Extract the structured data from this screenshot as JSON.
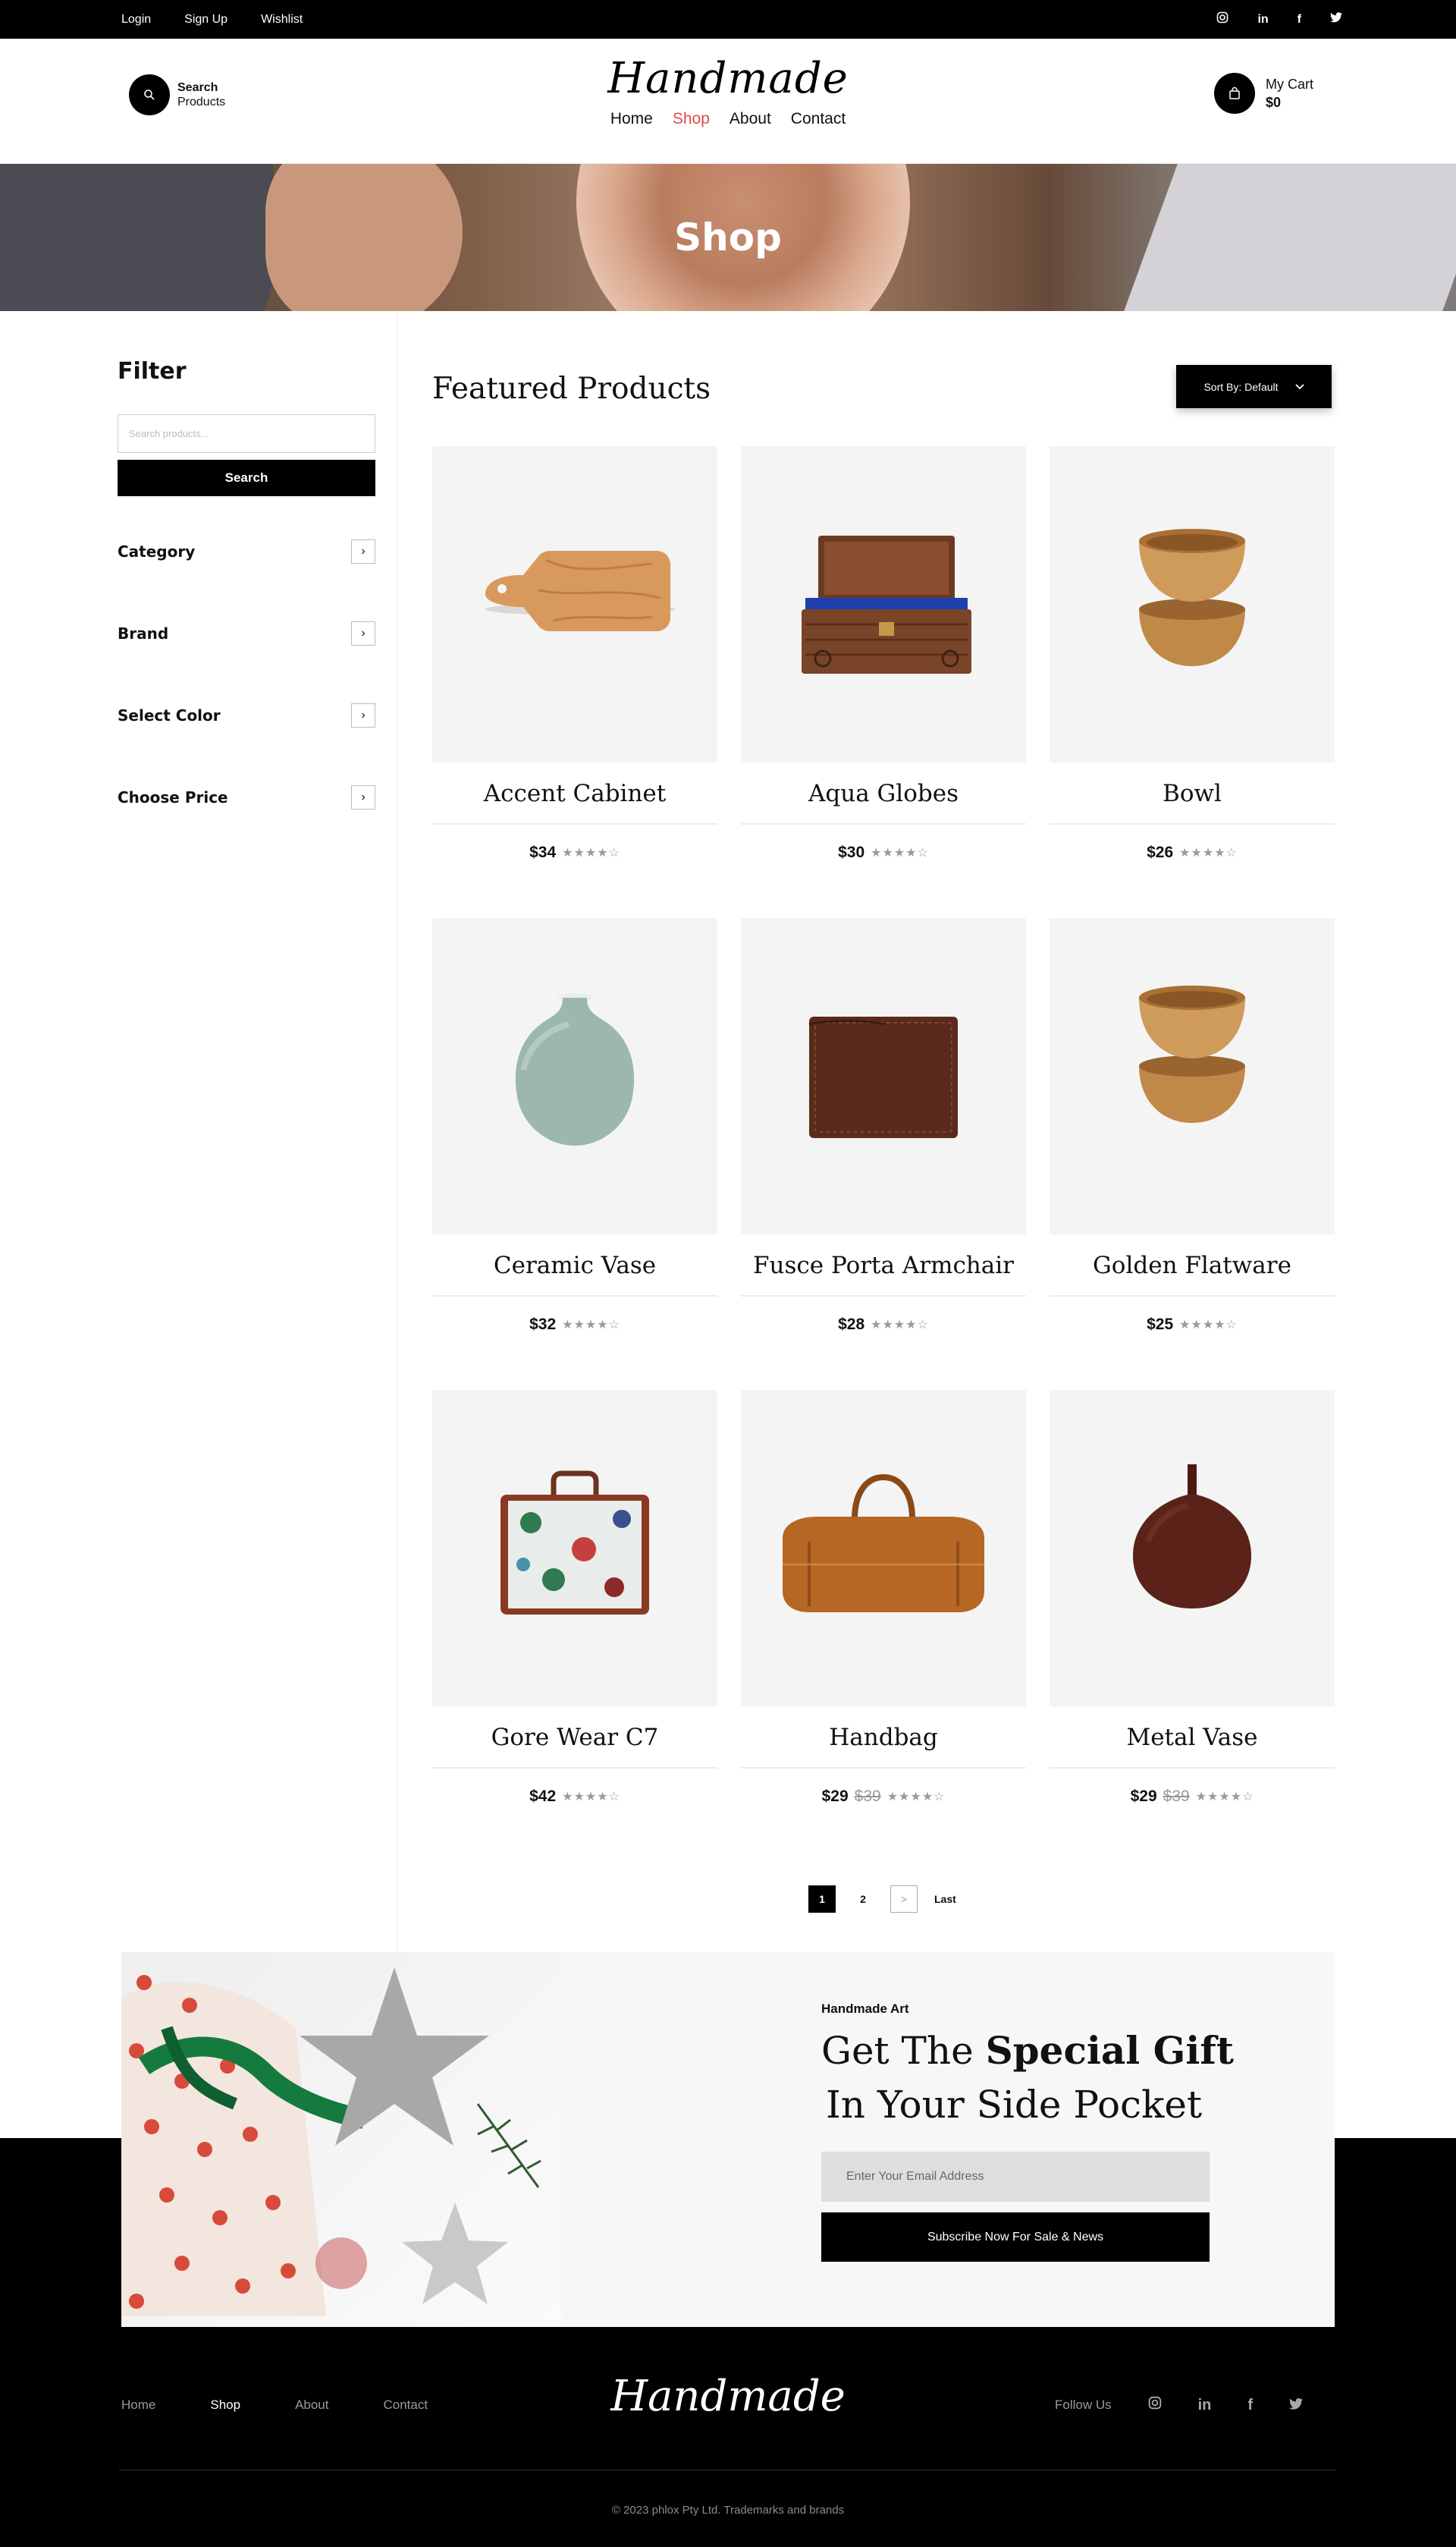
{
  "topbar": {
    "links": [
      "Login",
      "Sign Up",
      "Wishlist"
    ],
    "social": {
      "instagram": "◎",
      "linkedin": "in",
      "facebook": "f",
      "twitter": "🐦"
    }
  },
  "header": {
    "search_label": "Search",
    "search_sub": "Products",
    "logo": "Handmade",
    "nav": [
      "Home",
      "Shop",
      "About",
      "Contact"
    ],
    "cart_label": "My Cart",
    "cart_total": "$0",
    "active_color": "#e54848"
  },
  "hero": {
    "title": "Shop"
  },
  "sidebar": {
    "title": "Filter",
    "search_placeholder": "Search products...",
    "search_button": "Search",
    "facets": [
      "Category",
      "Brand",
      "Select Color",
      "Choose Price"
    ]
  },
  "main": {
    "title": "Featured Products",
    "sort_label": "Sort By: Default"
  },
  "products": [
    {
      "name": "Accent Cabinet",
      "price": "$34",
      "old_price": "",
      "rating": 4,
      "icon": "cutting-board"
    },
    {
      "name": "Aqua Globes",
      "price": "$30",
      "old_price": "",
      "rating": 4,
      "icon": "wooden-chest"
    },
    {
      "name": "Bowl",
      "price": "$26",
      "old_price": "",
      "rating": 4,
      "icon": "wooden-bowls"
    },
    {
      "name": "Ceramic Vase",
      "price": "$32",
      "old_price": "",
      "rating": 4,
      "icon": "ceramic-vase"
    },
    {
      "name": "Fusce Porta Armchair",
      "price": "$28",
      "old_price": "",
      "rating": 4,
      "icon": "leather-wallet"
    },
    {
      "name": "Golden Flatware",
      "price": "$25",
      "old_price": "",
      "rating": 4,
      "icon": "wooden-bowls"
    },
    {
      "name": "Gore Wear C7",
      "price": "$42",
      "old_price": "",
      "rating": 4,
      "icon": "floral-suitcase"
    },
    {
      "name": "Handbag",
      "price": "$29",
      "old_price": "$39",
      "rating": 4,
      "icon": "leather-duffel-bag"
    },
    {
      "name": "Metal Vase",
      "price": "$29",
      "old_price": "$39",
      "rating": 4,
      "icon": "dark-vase"
    }
  ],
  "pagination": {
    "pages": [
      "1",
      "2"
    ],
    "next": ">",
    "last": "Last"
  },
  "promo": {
    "eyebrow": "Handmade Art",
    "title_a": "Get The ",
    "title_b": "Special Gift",
    "title_line2": "In Your Side Pocket",
    "email_placeholder": "Enter Your Email Address",
    "button": "Subscribe Now For Sale & News"
  },
  "footer": {
    "nav": [
      "Home",
      "Shop",
      "About",
      "Contact"
    ],
    "logo": "Handmade",
    "follow": "Follow Us",
    "social": [
      "◎",
      "in",
      "f",
      "🐦"
    ],
    "copyright": "© 2023 phlox Pty Ltd. Trademarks and brands"
  }
}
